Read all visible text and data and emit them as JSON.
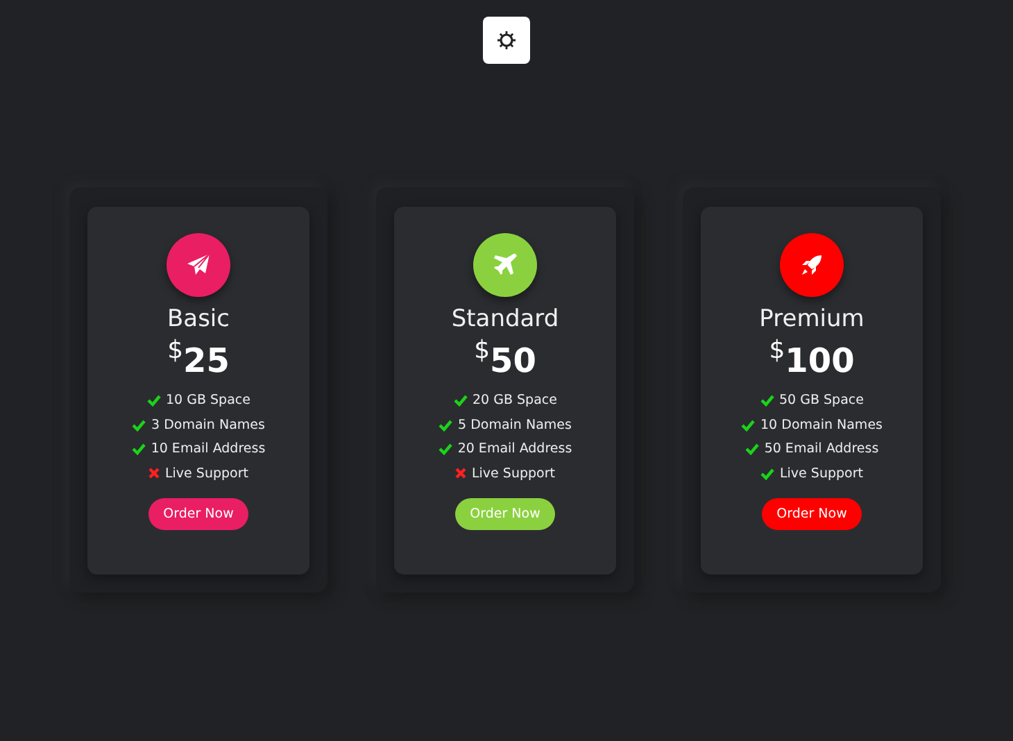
{
  "plans": [
    {
      "kind": "paper-plane",
      "color": "#e91e63",
      "name": "Basic",
      "currency": "$",
      "amount": "25",
      "features": [
        {
          "text": "10 GB Space",
          "included": true
        },
        {
          "text": "3 Domain Names",
          "included": true
        },
        {
          "text": "10 Email Address",
          "included": true
        },
        {
          "text": "Live Support",
          "included": false
        }
      ],
      "button": "Order Now"
    },
    {
      "kind": "airplane",
      "color": "#8bd13f",
      "name": "Standard",
      "currency": "$",
      "amount": "50",
      "features": [
        {
          "text": "20 GB Space",
          "included": true
        },
        {
          "text": "5 Domain Names",
          "included": true
        },
        {
          "text": "20 Email Address",
          "included": true
        },
        {
          "text": "Live Support",
          "included": false
        }
      ],
      "button": "Order Now"
    },
    {
      "kind": "rocket",
      "color": "#ff0000",
      "name": "Premium",
      "currency": "$",
      "amount": "100",
      "features": [
        {
          "text": "50 GB Space",
          "included": true
        },
        {
          "text": "10 Domain Names",
          "included": true
        },
        {
          "text": "50 Email Address",
          "included": true
        },
        {
          "text": "Live Support",
          "included": true
        }
      ],
      "button": "Order Now"
    }
  ]
}
